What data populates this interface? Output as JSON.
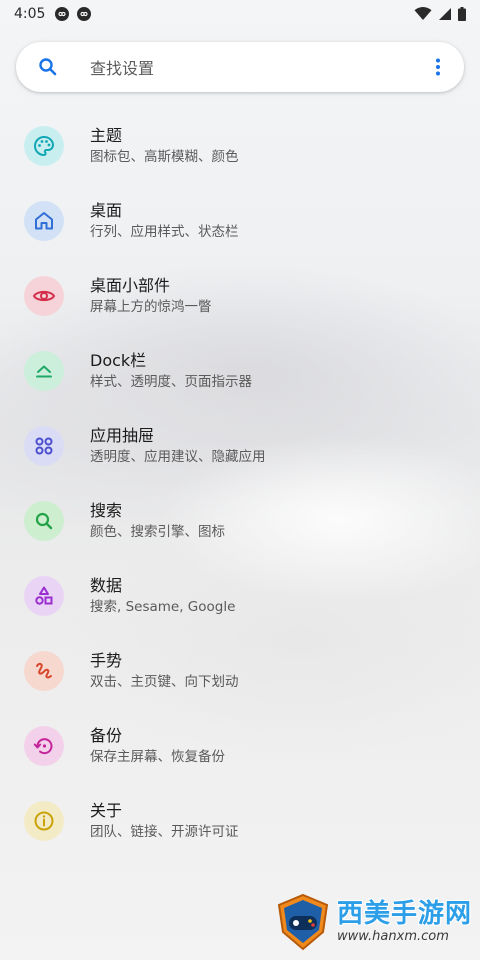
{
  "status_bar": {
    "time": "4:05",
    "badge_icons": [
      "loop-icon",
      "loop-icon"
    ],
    "right_icons": [
      "wifi-icon",
      "signal-icon",
      "battery-icon"
    ]
  },
  "search": {
    "placeholder": "查找设置",
    "accent": "#1a73e8"
  },
  "settings": {
    "items": [
      {
        "title": "主题",
        "subtitle": "图标包、高斯模糊、颜色",
        "icon": "palette-icon",
        "color": "#12a7b5",
        "bg": "#c9eef0"
      },
      {
        "title": "桌面",
        "subtitle": "行列、应用样式、状态栏",
        "icon": "home-icon",
        "color": "#2f6fd6",
        "bg": "#d3e1f7"
      },
      {
        "title": "桌面小部件",
        "subtitle": "屏幕上方的惊鸿一瞥",
        "icon": "eye-icon",
        "color": "#d32f4a",
        "bg": "#f6d3d8"
      },
      {
        "title": "Dock栏",
        "subtitle": "样式、透明度、页面指示器",
        "icon": "dock-icon",
        "color": "#1fa868",
        "bg": "#ccefdb"
      },
      {
        "title": "应用抽屉",
        "subtitle": "透明度、应用建议、隐藏应用",
        "icon": "apps-grid-icon",
        "color": "#4a4fd0",
        "bg": "#dadcf6"
      },
      {
        "title": "搜索",
        "subtitle": "颜色、搜索引擎、图标",
        "icon": "search-icon",
        "color": "#23a347",
        "bg": "#cdeecf"
      },
      {
        "title": "数据",
        "subtitle": "搜索, Sesame, Google",
        "icon": "shapes-icon",
        "color": "#9a2fd0",
        "bg": "#ead4f6"
      },
      {
        "title": "手势",
        "subtitle": "双击、主页键、向下划动",
        "icon": "gesture-icon",
        "color": "#d8462b",
        "bg": "#f6d8cf"
      },
      {
        "title": "备份",
        "subtitle": "保存主屏幕、恢复备份",
        "icon": "backup-restore-icon",
        "color": "#c4269a",
        "bg": "#f3d1ea"
      },
      {
        "title": "关于",
        "subtitle": "团队、链接、开源许可证",
        "icon": "info-icon",
        "color": "#c9a20a",
        "bg": "#f3ebc6"
      }
    ]
  },
  "watermark": {
    "title": "西美手游网",
    "url": "www.hanxm.com"
  }
}
